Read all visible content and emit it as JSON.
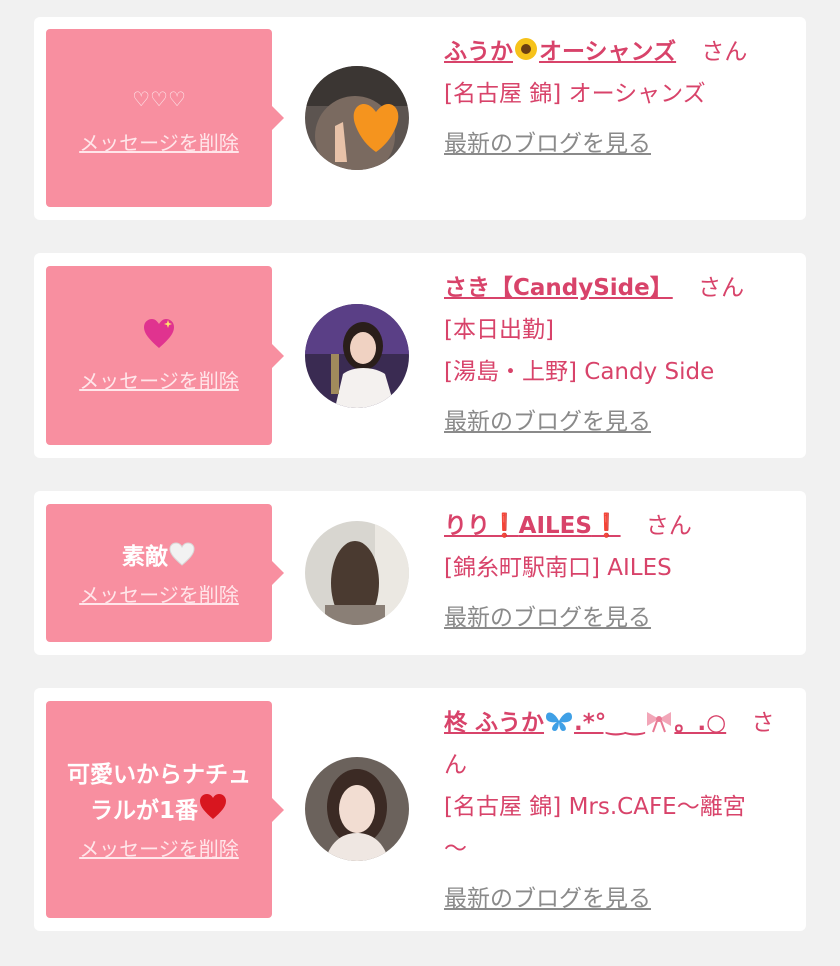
{
  "delete_label": "メッセージを削除",
  "blog_label": "最新のブログを見る",
  "san_label": "さん",
  "cards": [
    {
      "message": "♡♡♡",
      "name_pre": "ふうか",
      "name_post": "オーシャンズ",
      "lines": [
        "[名古屋 錦] オーシャンズ"
      ]
    },
    {
      "message": "",
      "name_pre": "さき【CandySide】",
      "name_post": "",
      "lines": [
        "[本日出勤]",
        "[湯島・上野] Candy Side"
      ]
    },
    {
      "message": "素敵",
      "name_pre": "りり",
      "name_mid": "AILES",
      "name_post": "",
      "lines": [
        "[錦糸町駅南口] AILES"
      ]
    },
    {
      "message_line1": "可愛いからナチュ",
      "message_line2": "ラルが1番",
      "name_pre": "柊 ふうか",
      "name_post": ".*°‿‿",
      "name_tail": "。.○",
      "lines": [
        "[名古屋 錦] Mrs.CAFE〜離宮",
        "〜"
      ]
    }
  ],
  "colors": {
    "accent": "#d8436a",
    "bubble": "#f88fa0",
    "link_gray": "#8a8a8a",
    "background": "#f1f1f1"
  }
}
